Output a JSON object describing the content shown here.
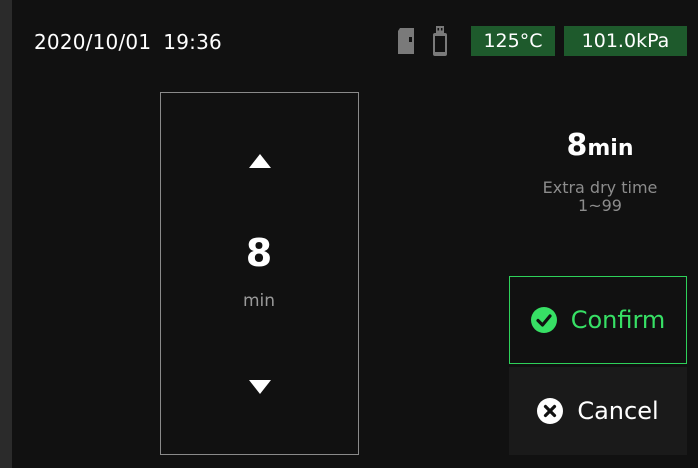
{
  "status_bar": {
    "date": "2020/10/01",
    "time": "19:36",
    "temperature": "125°C",
    "pressure": "101.0kPa",
    "icons": [
      "sd-card-icon",
      "usb-icon"
    ]
  },
  "picker": {
    "value": "8",
    "unit": "min",
    "up_icon": "triangle-up-icon",
    "down_icon": "triangle-down-icon"
  },
  "summary": {
    "value": "8",
    "unit": "min",
    "label": "Extra dry time",
    "range": "1~99"
  },
  "actions": {
    "confirm_label": "Confirm",
    "cancel_label": "Cancel",
    "confirm_icon": "check-circle-icon",
    "cancel_icon": "x-circle-icon"
  },
  "colors": {
    "background": "#111111",
    "badge_bg": "#1e5a2c",
    "confirm_accent": "#37e065",
    "muted_text": "#8c8c8c"
  }
}
